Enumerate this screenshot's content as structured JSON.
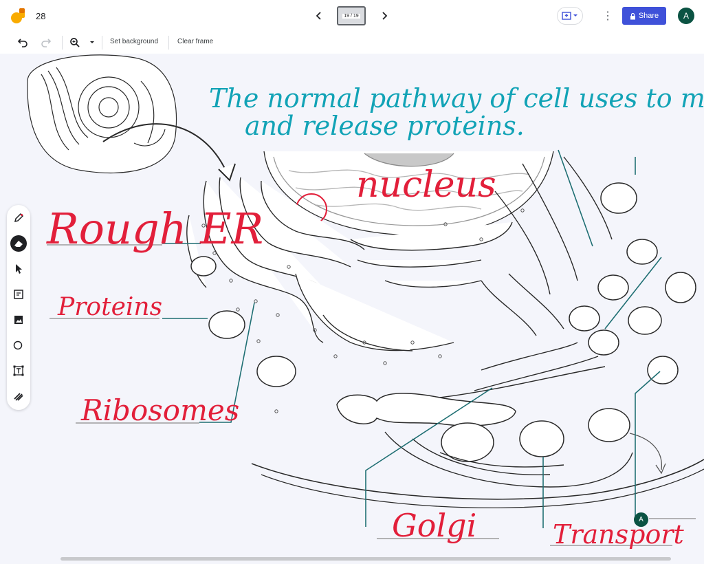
{
  "header": {
    "frame_number": "28",
    "frame_counter": "19 / 19",
    "share_label": "Share",
    "avatar_initial": "A"
  },
  "toolbar": {
    "set_background_label": "Set background",
    "clear_frame_label": "Clear frame"
  },
  "canvas": {
    "title_line1": "The normal pathway of cell uses to make",
    "title_line2": "and release proteins.",
    "labels": {
      "nucleus": "nucleus",
      "rough_er": "Rough ER",
      "proteins": "Proteins",
      "ribosomes": "Ribosomes",
      "golgi": "Golgi",
      "transport": "Transport"
    },
    "collaborator_initial": "A"
  },
  "side_tools": [
    "pen-icon",
    "eraser-icon",
    "select-arrow-icon",
    "sticky-note-icon",
    "image-icon",
    "circle-shape-icon",
    "text-box-icon",
    "laser-icon"
  ],
  "colors": {
    "share_button": "#3f51d9",
    "avatar": "#0b5343",
    "annotation_red": "#e21f3a",
    "annotation_teal": "#12a3b6"
  }
}
